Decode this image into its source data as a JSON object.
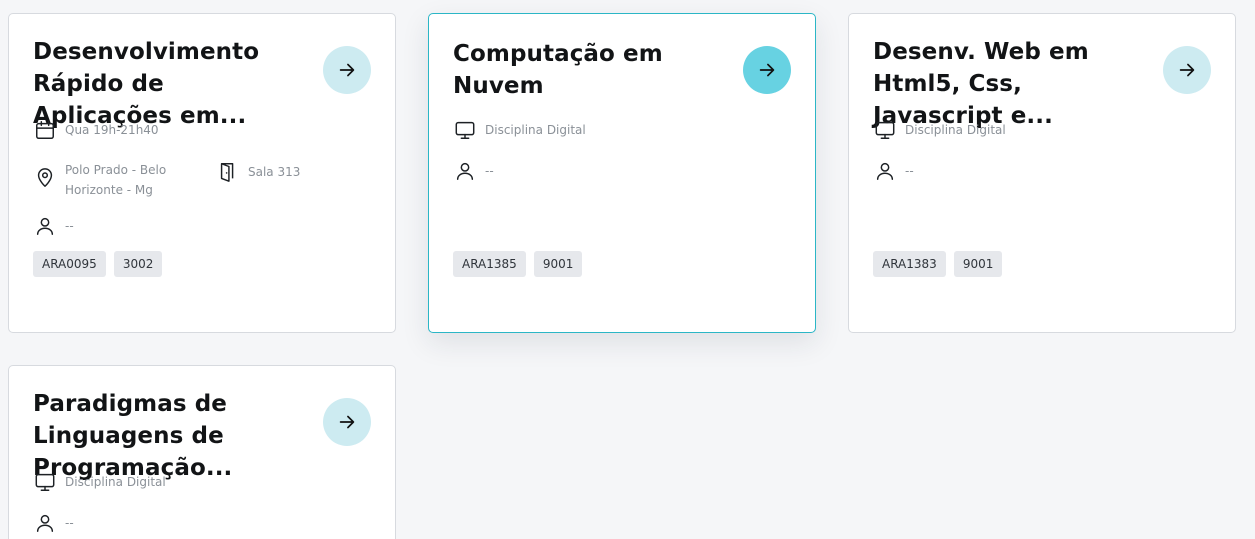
{
  "cards": [
    {
      "title": "Desenvolvimento Rápido de Aplicações em...",
      "schedule": "Qua 19h-21h40",
      "location": "Polo Prado - Belo Horizonte - Mg",
      "room": "Sala 313",
      "teacher": "--",
      "tags": [
        "ARA0095",
        "3002"
      ]
    },
    {
      "title": "Computação em Nuvem",
      "modality": "Disciplina Digital",
      "teacher": "--",
      "tags": [
        "ARA1385",
        "9001"
      ]
    },
    {
      "title": "Desenv. Web em Html5, Css, Javascript e...",
      "modality": "Disciplina Digital",
      "teacher": "--",
      "tags": [
        "ARA1383",
        "9001"
      ]
    },
    {
      "title": "Paradigmas de Linguagens de Programação...",
      "modality": "Disciplina Digital",
      "teacher": "--",
      "tags": []
    }
  ],
  "colors": {
    "accent": "#67d2e2",
    "accent_light": "#cdebf1",
    "active_border": "#2bb6c6",
    "page_bg": "#f5f6f8"
  },
  "icons": [
    "calendar-icon",
    "location-pin-icon",
    "door-icon",
    "user-icon",
    "monitor-icon",
    "arrow-right-icon"
  ]
}
